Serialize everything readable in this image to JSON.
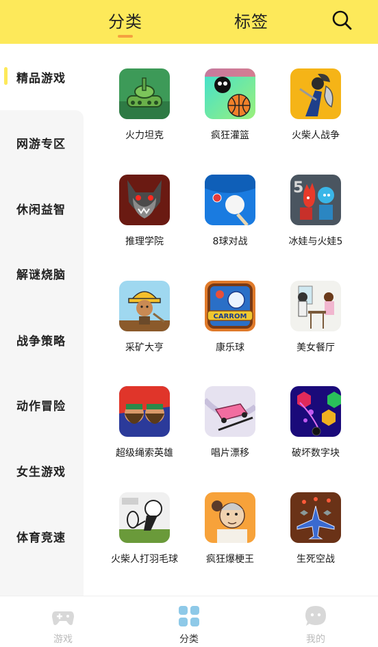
{
  "header": {
    "tabs": [
      {
        "label": "分类",
        "active": true
      },
      {
        "label": "标签",
        "active": false
      }
    ],
    "search_icon": "search-icon",
    "bg_color": "#fde95a",
    "accent_color": "#f5a040"
  },
  "sidebar": {
    "items": [
      {
        "label": "精品游戏",
        "active": true
      },
      {
        "label": "网游专区"
      },
      {
        "label": "休闲益智"
      },
      {
        "label": "解谜烧脑"
      },
      {
        "label": "战争策略"
      },
      {
        "label": "动作冒险"
      },
      {
        "label": "女生游戏"
      },
      {
        "label": "体育竞速"
      }
    ]
  },
  "games": [
    {
      "name": "火力坦克",
      "icon": "tank-icon"
    },
    {
      "name": "疯狂灌篮",
      "icon": "basketball-icon"
    },
    {
      "name": "火柴人战争",
      "icon": "spartan-icon"
    },
    {
      "name": "推理学院",
      "icon": "werewolf-icon"
    },
    {
      "name": "8球对战",
      "icon": "billiards-icon"
    },
    {
      "name": "冰娃与火娃5",
      "icon": "fire-ice-icon"
    },
    {
      "name": "采矿大亨",
      "icon": "miner-icon"
    },
    {
      "name": "康乐球",
      "icon": "carrom-icon"
    },
    {
      "name": "美女餐厅",
      "icon": "restaurant-icon"
    },
    {
      "name": "超级绳索英雄",
      "icon": "rope-hero-icon"
    },
    {
      "name": "唱片漂移",
      "icon": "drift-car-icon"
    },
    {
      "name": "破坏数字块",
      "icon": "number-blocks-icon"
    },
    {
      "name": "火柴人打羽毛球",
      "icon": "badminton-icon"
    },
    {
      "name": "疯狂爆梗王",
      "icon": "meme-king-icon"
    },
    {
      "name": "生死空战",
      "icon": "air-combat-icon"
    }
  ],
  "icon_text": {
    "carrom": "CARROM",
    "fire_ice_number": "5"
  },
  "bottom_nav": [
    {
      "label": "游戏",
      "icon": "gamepad-icon",
      "active": false
    },
    {
      "label": "分类",
      "icon": "grid-icon",
      "active": true
    },
    {
      "label": "我的",
      "icon": "profile-icon",
      "active": false
    }
  ]
}
